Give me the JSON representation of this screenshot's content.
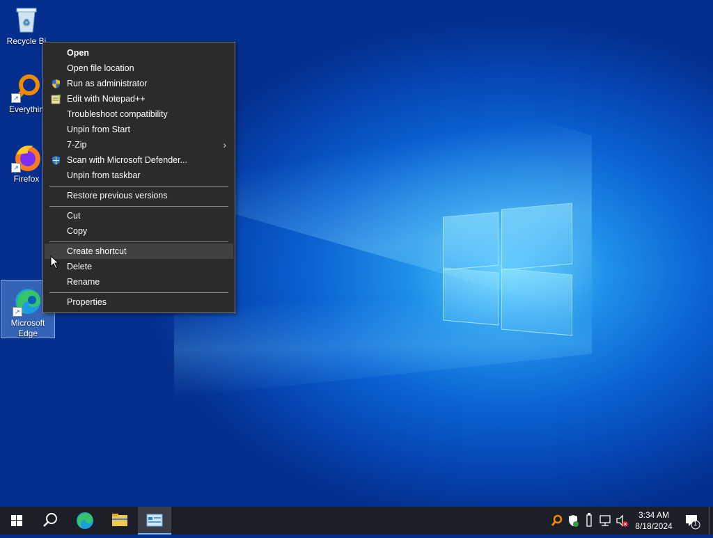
{
  "desktop": {
    "icons": [
      {
        "label": "Recycle Bin",
        "visible_label": "Recycle Bi"
      },
      {
        "label": "Everything",
        "visible_label": "Everythin"
      },
      {
        "label": "Firefox"
      },
      {
        "label": "Microsoft Edge"
      }
    ]
  },
  "context_menu": {
    "items": [
      {
        "label": "Open",
        "bold": true
      },
      {
        "label": "Open file location"
      },
      {
        "label": "Run as administrator",
        "icon": "uac-shield-icon"
      },
      {
        "label": "Edit with Notepad++",
        "icon": "notepad-plus-plus-icon"
      },
      {
        "label": "Troubleshoot compatibility"
      },
      {
        "label": "Unpin from Start"
      },
      {
        "label": "7-Zip",
        "submenu": true
      },
      {
        "label": "Scan with Microsoft Defender...",
        "icon": "defender-shield-icon"
      },
      {
        "label": "Unpin from taskbar"
      },
      {
        "label": "Restore previous versions"
      },
      {
        "label": "Cut"
      },
      {
        "label": "Copy"
      },
      {
        "label": "Create shortcut",
        "highlighted": true
      },
      {
        "label": "Delete"
      },
      {
        "label": "Rename"
      },
      {
        "label": "Properties"
      }
    ],
    "submenu_arrow": "›"
  },
  "taskbar": {
    "apps": [
      "start-icon",
      "search-icon",
      "edge-icon",
      "file-explorer-icon",
      "control-panel-icon"
    ],
    "tray_icons": [
      "everything-icon",
      "defender-icon",
      "usb-icon",
      "network-icon",
      "volume-muted-icon"
    ],
    "time": "3:34 AM",
    "date": "8/18/2024",
    "notification_count": "1"
  },
  "colors": {
    "menu_bg": "#2b2b2b",
    "menu_hover": "#414141",
    "taskbar_bg": "#1c1f27",
    "accent": "#0a62d2"
  }
}
